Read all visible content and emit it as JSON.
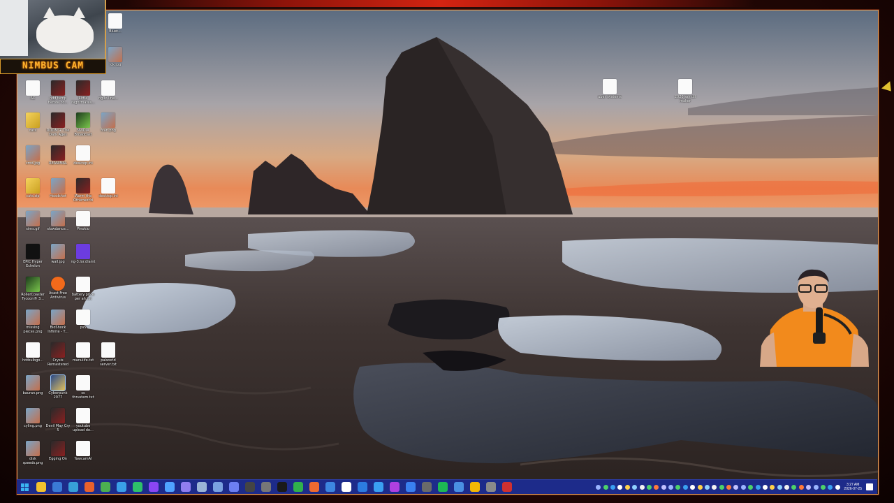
{
  "stream": {
    "logo_text": "NIMBUS CAM"
  },
  "desktop_icons": [
    {
      "label": "Bluet...",
      "type": "doc"
    },
    {
      "label": "ick.jpg",
      "type": "img"
    },
    {
      "label": "AC",
      "type": "doc"
    },
    {
      "label": "hdd temp before co...",
      "type": "game1"
    },
    {
      "label": "Little Nightmares...",
      "type": "game1"
    },
    {
      "label": "ng3c-line...",
      "type": "doc"
    },
    {
      "label": "cats",
      "type": "zip"
    },
    {
      "label": "DOOM + The Dark Ages",
      "type": "game1"
    },
    {
      "label": "NVIDIA Broadcast",
      "type": "game2"
    },
    {
      "label": "fcan.png",
      "type": "img"
    },
    {
      "label": "cmd.jpg",
      "type": "img"
    },
    {
      "label": "REANIMAL",
      "type": "game1"
    },
    {
      "label": "desktop.ini",
      "type": "doc"
    },
    {
      "label": "cats.zip",
      "type": "zip"
    },
    {
      "label": "Headshot",
      "type": "img"
    },
    {
      "label": "Warm the Otherworld",
      "type": "game1"
    },
    {
      "label": "desktop.ini",
      "type": "doc"
    },
    {
      "label": "sims.gif",
      "type": "img"
    },
    {
      "label": "slowdance...",
      "type": "img"
    },
    {
      "label": "Pinokio",
      "type": "doc"
    },
    {
      "label": "EPIC Hyper Echelon",
      "type": "epic"
    },
    {
      "label": "wall.jpg",
      "type": "img"
    },
    {
      "label": "ng-3.lor.dlamt",
      "type": "purple"
    },
    {
      "label": "RollerCoaster Tycoon® 3...",
      "type": "game2"
    },
    {
      "label": "Avast Free Antivirus",
      "type": "avast"
    },
    {
      "label": "battery price per ah.txt",
      "type": "doc"
    },
    {
      "label": "missing pieces.png",
      "type": "img"
    },
    {
      "label": "BioShock Infinite - T...",
      "type": "img"
    },
    {
      "label": "ps5",
      "type": "doc"
    },
    {
      "label": "hotbulbgo...",
      "type": "doc"
    },
    {
      "label": "Crysis Remastered",
      "type": "game1"
    },
    {
      "label": "manulife.txt",
      "type": "doc"
    },
    {
      "label": "palworld server.txt",
      "type": "doc"
    },
    {
      "label": "bauran.png",
      "type": "img"
    },
    {
      "label": "Cyberpunk 2077",
      "type": "sel"
    },
    {
      "label": "ss thrustem.txt",
      "type": "doc"
    },
    {
      "label": "cyling.png",
      "type": "img"
    },
    {
      "label": "Devil May Cry 5",
      "type": "game1"
    },
    {
      "label": "youtube upload de...",
      "type": "doc"
    },
    {
      "label": "disk speeds.png",
      "type": "img"
    },
    {
      "label": "Egging On",
      "type": "game1"
    },
    {
      "label": "YawcamAI",
      "type": "doc"
    },
    {
      "label": "uber systems",
      "type": "doc"
    },
    {
      "label": "2020 ssh.dll maker",
      "type": "doc"
    }
  ],
  "taskbar": {
    "apps": [
      {
        "icon": "windows-start-icon",
        "color": "#2aa8f2"
      },
      {
        "icon": "file-explorer-icon",
        "color": "#f2c12e"
      },
      {
        "icon": "task-view-icon",
        "color": "#3a7bd5"
      },
      {
        "icon": "edge-icon",
        "color": "#37a0d8"
      },
      {
        "icon": "firefox-icon",
        "color": "#e8612c"
      },
      {
        "icon": "chrome-icon",
        "color": "#4caf50"
      },
      {
        "icon": "refresh-app-icon",
        "color": "#3aa0e8"
      },
      {
        "icon": "green-app-icon",
        "color": "#2ec26a"
      },
      {
        "icon": "twitch-icon",
        "color": "#8b46f4"
      },
      {
        "icon": "diamond-app-icon",
        "color": "#4fa3ff"
      },
      {
        "icon": "controller-icon",
        "color": "#8f7df0"
      },
      {
        "icon": "steam-icon",
        "color": "#9bb5d6"
      },
      {
        "icon": "folder-app-icon",
        "color": "#7aa2e0"
      },
      {
        "icon": "discord-icon",
        "color": "#6c7ff2"
      },
      {
        "icon": "obs-icon",
        "color": "#444444"
      },
      {
        "icon": "gear-app-icon",
        "color": "#777777"
      },
      {
        "icon": "terminal-icon",
        "color": "#1a1a1a"
      },
      {
        "icon": "sheet-app-icon",
        "color": "#30b04c"
      },
      {
        "icon": "fox-app-icon",
        "color": "#f06a30"
      },
      {
        "icon": "grid-app-icon",
        "color": "#3d86e0"
      },
      {
        "icon": "notepad-icon",
        "color": "#ffffff"
      },
      {
        "icon": "blue-app-icon",
        "color": "#2c7ce0"
      },
      {
        "icon": "chat-app-icon",
        "color": "#3aa0f2"
      },
      {
        "icon": "purple-app-icon",
        "color": "#b040e0"
      },
      {
        "icon": "blue-sphere-icon",
        "color": "#3a80f0"
      },
      {
        "icon": "settings-icon",
        "color": "#6a6a6a"
      },
      {
        "icon": "spotify-icon",
        "color": "#1db954"
      },
      {
        "icon": "docs-app-icon",
        "color": "#4a90e2"
      },
      {
        "icon": "star-app-icon",
        "color": "#f2b705"
      },
      {
        "icon": "grey-app-icon",
        "color": "#8a8a8a"
      },
      {
        "icon": "red-app-icon",
        "color": "#d03030"
      }
    ],
    "tray_count": 34,
    "clock_time": "3:27 AM",
    "clock_date": "2026-07-25"
  }
}
